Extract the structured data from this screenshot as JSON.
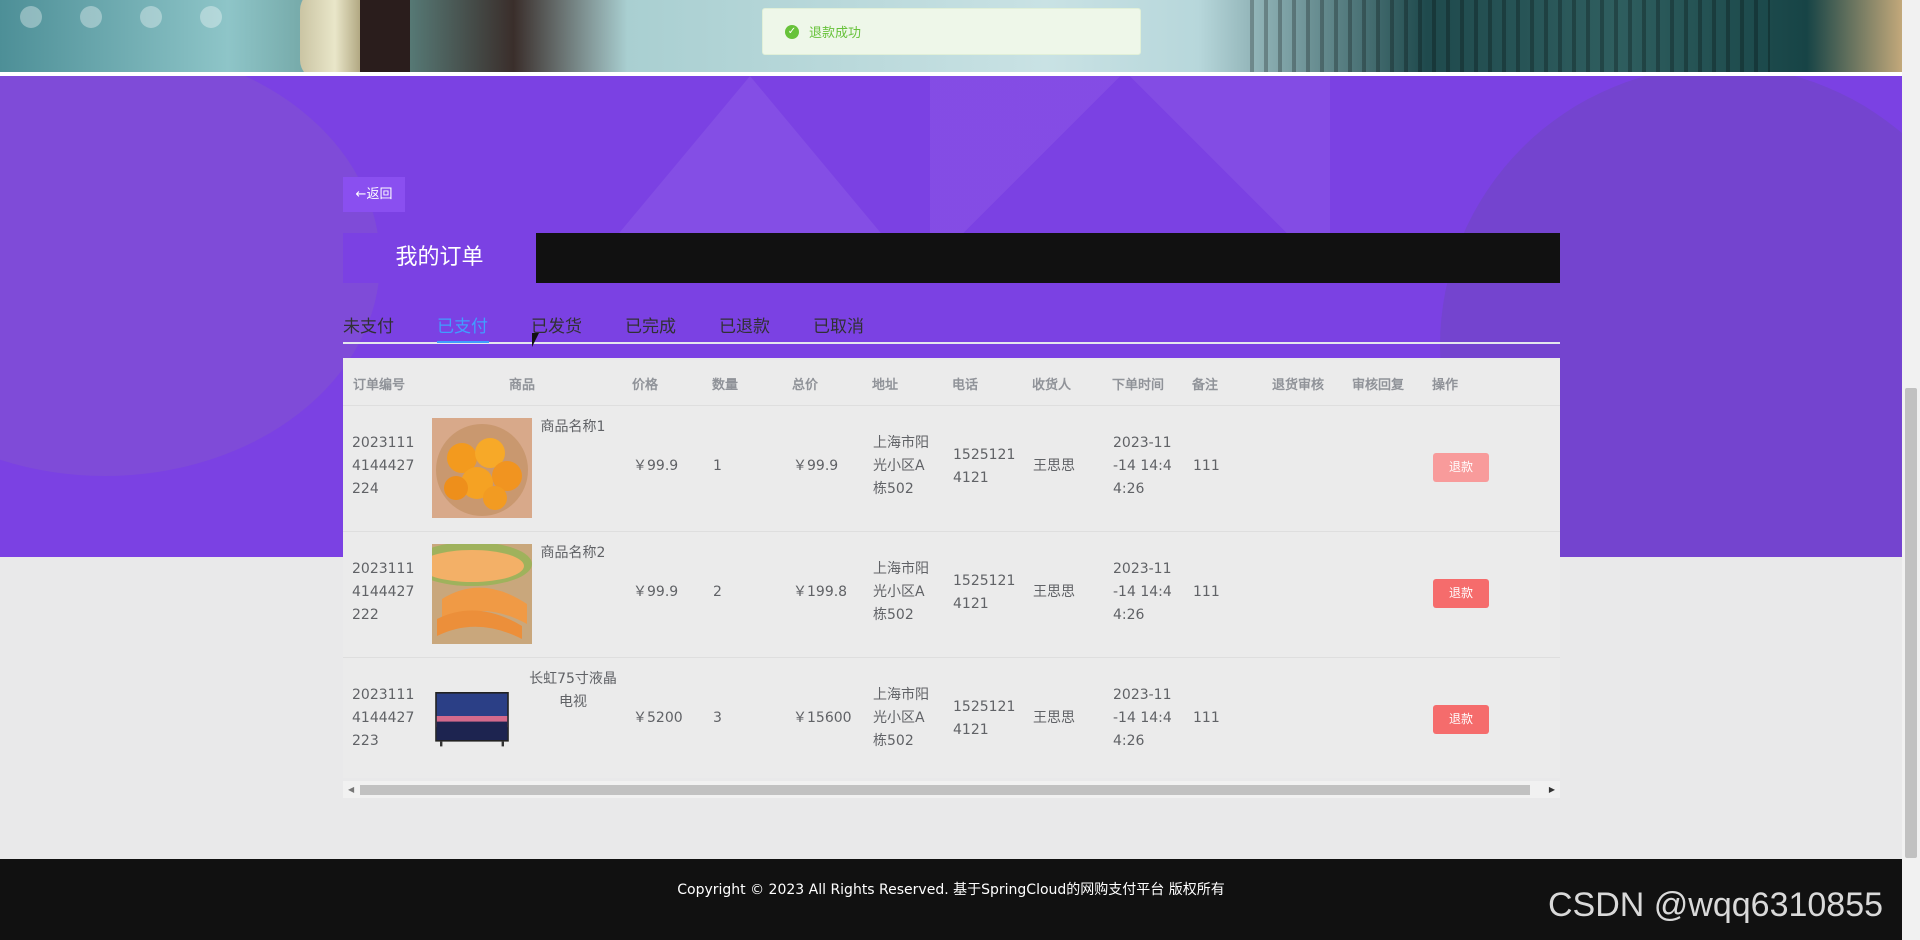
{
  "toast": {
    "message": "退款成功"
  },
  "back_label": "←返回",
  "page_title": "我的订单",
  "tabs": [
    "未支付",
    "已支付",
    "已发货",
    "已完成",
    "已退款",
    "已取消"
  ],
  "active_tab": "已支付",
  "columns": [
    "订单编号",
    "商品",
    "价格",
    "数量",
    "总价",
    "地址",
    "电话",
    "收货人",
    "下单时间",
    "备注",
    "退货审核",
    "审核回复",
    "操作"
  ],
  "orders": [
    {
      "id": [
        "2023111",
        "4144427",
        "224"
      ],
      "product": [
        "商品名称1"
      ],
      "image": "orange-fruit-image",
      "price": "￥99.9",
      "qty": "1",
      "total": "￥99.9",
      "address": [
        "上海市阳",
        "光小区A",
        "栋502"
      ],
      "phone": [
        "1525121",
        "4121"
      ],
      "receiver": "王思思",
      "time": [
        "2023-11",
        "-14 14:4",
        "4:26"
      ],
      "note": "111",
      "action": "退款"
    },
    {
      "id": [
        "2023111",
        "4144427",
        "222"
      ],
      "product": [
        "商品名称2"
      ],
      "image": "melon-fruit-image",
      "price": "￥99.9",
      "qty": "2",
      "total": "￥199.8",
      "address": [
        "上海市阳",
        "光小区A",
        "栋502"
      ],
      "phone": [
        "1525121",
        "4121"
      ],
      "receiver": "王思思",
      "time": [
        "2023-11",
        "-14 14:4",
        "4:26"
      ],
      "note": "111",
      "action": "退款"
    },
    {
      "id": [
        "2023111",
        "4144427",
        "223"
      ],
      "product": [
        "长虹75寸液晶",
        "电视"
      ],
      "image": "tv-image",
      "price": "￥5200",
      "qty": "3",
      "total": "￥15600",
      "address": [
        "上海市阳",
        "光小区A",
        "栋502"
      ],
      "phone": [
        "1525121",
        "4121"
      ],
      "receiver": "王思思",
      "time": [
        "2023-11",
        "-14 14:4",
        "4:26"
      ],
      "note": "111",
      "action": "退款"
    }
  ],
  "footer": {
    "copyright": "Copyright © 2023 All Rights Reserved. 基于SpringCloud的网购支付平台 版权所有"
  },
  "watermark": "CSDN @wqq6310855",
  "colors": {
    "purple": "#7b41e3",
    "active_tab": "#409eff",
    "refund": "#f56c6c",
    "success": "#67c23a"
  }
}
